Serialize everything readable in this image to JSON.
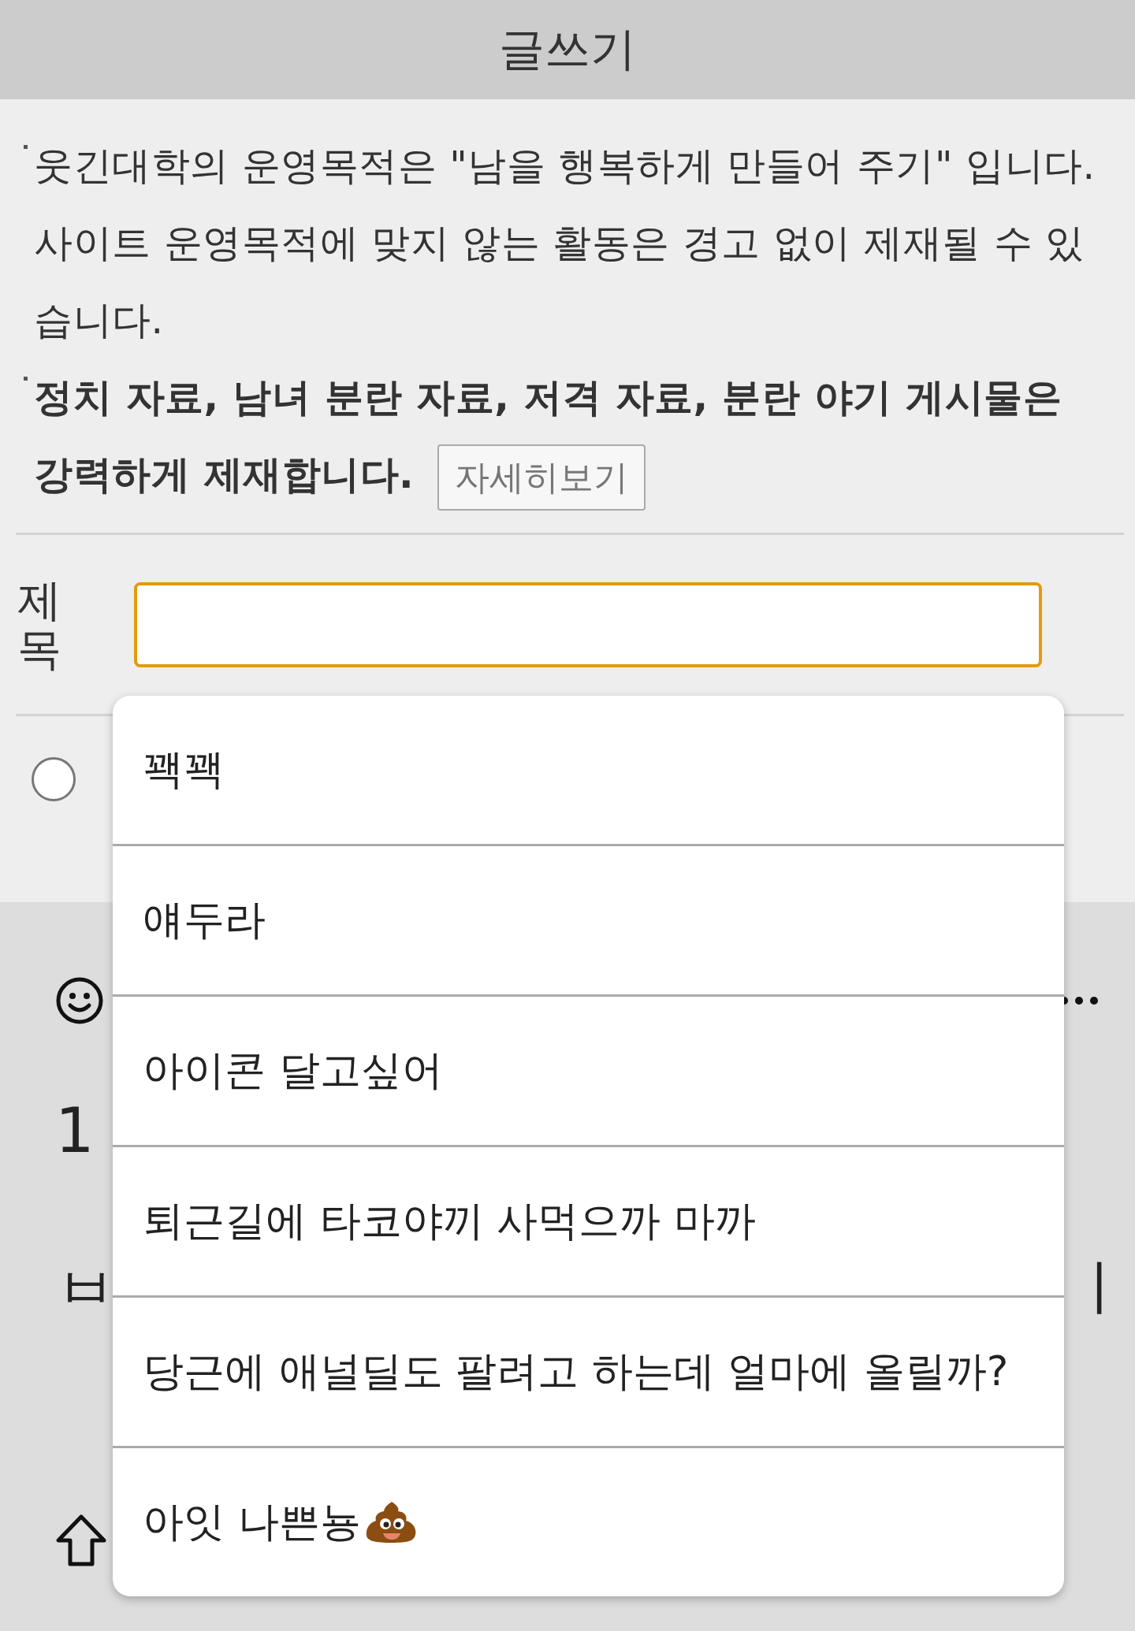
{
  "header": {
    "title": "글쓰기"
  },
  "notices": [
    {
      "text": "웃긴대학의 운영목적은 \"남을 행복하게 만들어 주기\" 입니다. 사이트 운영목적에 맞지 않는 활동은 경고 없이 제재될 수 있습니다.",
      "bold": false
    },
    {
      "text": "정치 자료, 남녀 분란 자료, 저격 자료, 분란 야기 게시물은 강력하게 제재합니다.",
      "bold": true,
      "button": "자세히보기"
    }
  ],
  "form": {
    "title_label": "제목",
    "title_field": {
      "focused": true
    },
    "radio": {
      "selected": false
    }
  },
  "keyboard": {
    "rows": [
      [
        "1"
      ],
      [
        "ㅂ",
        "ㅣ"
      ]
    ]
  },
  "suggestions": [
    {
      "text": "꽥꽥"
    },
    {
      "text": "얘두라"
    },
    {
      "text": "아이콘 달고싶어"
    },
    {
      "text": "퇴근길에 타코야끼 사먹으까 마까"
    },
    {
      "text": "당근에 애널딜도 팔려고 하는데 얼마에 올릴까?"
    },
    {
      "text": "아잇 나쁜뇽",
      "kind": "poop"
    }
  ]
}
